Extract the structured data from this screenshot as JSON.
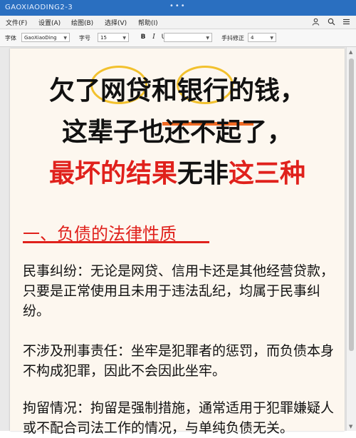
{
  "window": {
    "title": "GAOXIAODING2-3",
    "dots": "•••"
  },
  "menu": {
    "items": [
      "文件(F)",
      "设置(A)",
      "绘图(B)",
      "选择(V)",
      "帮助(I)"
    ]
  },
  "toolbar": {
    "font_label": "字体",
    "font_value": "GaoXiaoDing",
    "size_label": "字号",
    "size_value": "15",
    "bold": "B",
    "italic": "I",
    "underline": "U",
    "adjust_label": "手抖修正",
    "adjust_value": "4"
  },
  "headline": {
    "line1": {
      "part1": "欠了",
      "part2": "网贷",
      "part3": "和",
      "part4": "银行",
      "part5": "的钱，"
    },
    "line2": {
      "part1": "这辈子也",
      "part2": "还不起",
      "part3": "了，"
    },
    "line3": {
      "part1": "最坏的结果",
      "part2": "无非",
      "part3": "这三种"
    }
  },
  "section": {
    "title": "一、负债的法律性质"
  },
  "paragraphs": [
    "民事纠纷：无论是网贷、信用卡还是其他经营贷款，只要是正常使用且未用于违法乱纪，均属于民事纠纷。",
    "不涉及刑事责任：坐牢是犯罪者的惩罚，而负债本身不构成犯罪，因此不会因此坐牢。",
    "拘留情况：拘留是强制措施，通常适用于犯罪嫌疑人或不配合司法工作的情况，与单纯负债无关。"
  ],
  "colors": {
    "accent_red": "#e0211c",
    "highlight_yellow": "#f2c12e",
    "strike_orange": "#f06a24",
    "titlebar_blue": "#2a6fc0",
    "paper": "#fdf7ef"
  }
}
